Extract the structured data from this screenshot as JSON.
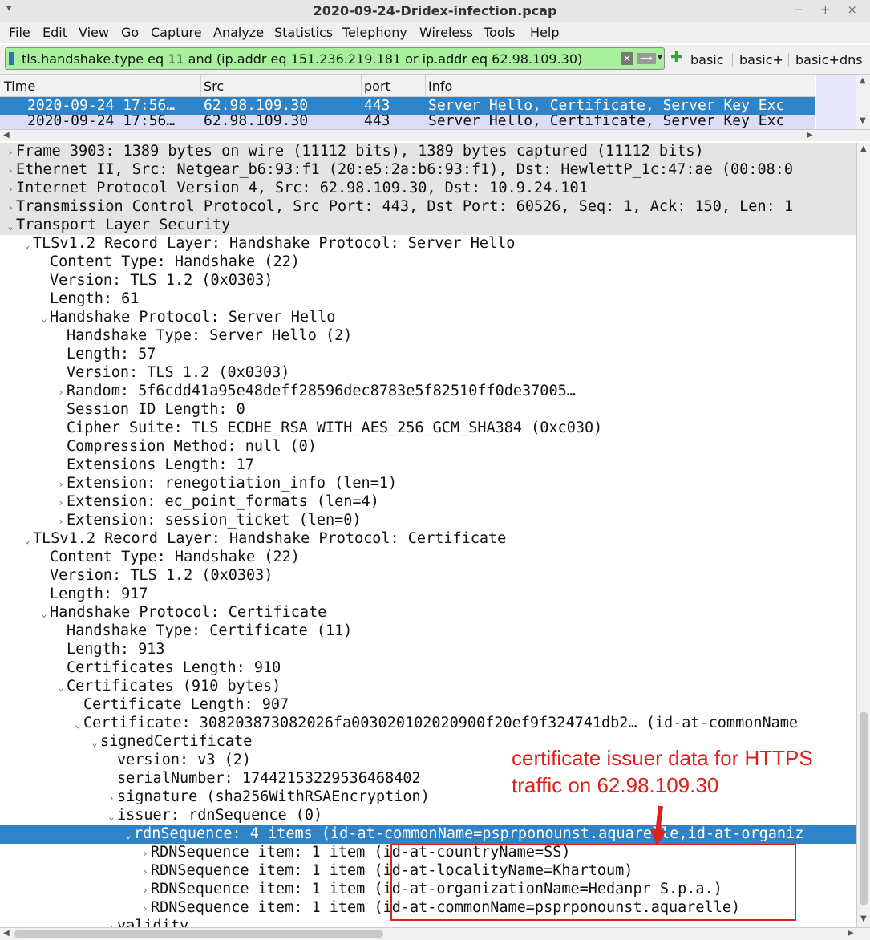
{
  "window": {
    "title": "2020-09-24-Dridex-infection.pcap",
    "menu_glyph": "▾",
    "controls": "− + ×"
  },
  "menubar": [
    "File",
    "Edit",
    "View",
    "Go",
    "Capture",
    "Analyze",
    "Statistics",
    "Telephony",
    "Wireless",
    "Tools",
    "Help"
  ],
  "filter": {
    "value": "tls.handshake.type eq 11 and (ip.addr eq 151.236.219.181 or ip.addr eq 62.98.109.30)",
    "clear_glyph": "✕",
    "apply_glyph": "⟶",
    "dropdown_glyph": "▾",
    "add_glyph": "✚",
    "buttons": [
      "basic",
      "basic+",
      "basic+dns"
    ],
    "bg_color": "#a8f09c"
  },
  "packet_list": {
    "columns": [
      "Time",
      "Src",
      "port",
      "Info"
    ],
    "rows": [
      {
        "time": "2020-09-24 17:56…",
        "src": "62.98.109.30",
        "port": "443",
        "info": "Server Hello, Certificate, Server Key Exc"
      },
      {
        "time": "2020-09-24 17:56…",
        "src": "62.98.109.30",
        "port": "443",
        "info": "Server Hello, Certificate, Server Key Exc"
      }
    ]
  },
  "tree": [
    {
      "t": "Frame 3903: 1389 bytes on wire (11112 bits), 1389 bytes captured (11112 bits)",
      "tog": "›",
      "indent": 0
    },
    {
      "t": "Ethernet II, Src: Netgear_b6:93:f1 (20:e5:2a:b6:93:f1), Dst: HewlettP_1c:47:ae (00:08:0",
      "tog": "›",
      "indent": 0
    },
    {
      "t": "Internet Protocol Version 4, Src: 62.98.109.30, Dst: 10.9.24.101",
      "tog": "›",
      "indent": 0
    },
    {
      "t": "Transmission Control Protocol, Src Port: 443, Dst Port: 60526, Seq: 1, Ack: 150, Len: 1",
      "tog": "›",
      "indent": 0
    },
    {
      "t": "Transport Layer Security",
      "tog": "⌄",
      "indent": 0
    },
    {
      "t": "TLSv1.2 Record Layer: Handshake Protocol: Server Hello",
      "tog": "⌄",
      "indent": 1
    },
    {
      "t": "Content Type: Handshake (22)",
      "tog": "",
      "indent": 2
    },
    {
      "t": "Version: TLS 1.2 (0x0303)",
      "tog": "",
      "indent": 2
    },
    {
      "t": "Length: 61",
      "tog": "",
      "indent": 2
    },
    {
      "t": "Handshake Protocol: Server Hello",
      "tog": "⌄",
      "indent": 2
    },
    {
      "t": "Handshake Type: Server Hello (2)",
      "tog": "",
      "indent": 3
    },
    {
      "t": "Length: 57",
      "tog": "",
      "indent": 3
    },
    {
      "t": "Version: TLS 1.2 (0x0303)",
      "tog": "",
      "indent": 3
    },
    {
      "t": "Random: 5f6cdd41a95e48deff28596dec8783e5f82510ff0de37005…",
      "tog": "›",
      "indent": 3
    },
    {
      "t": "Session ID Length: 0",
      "tog": "",
      "indent": 3
    },
    {
      "t": "Cipher Suite: TLS_ECDHE_RSA_WITH_AES_256_GCM_SHA384 (0xc030)",
      "tog": "",
      "indent": 3
    },
    {
      "t": "Compression Method: null (0)",
      "tog": "",
      "indent": 3
    },
    {
      "t": "Extensions Length: 17",
      "tog": "",
      "indent": 3
    },
    {
      "t": "Extension: renegotiation_info (len=1)",
      "tog": "›",
      "indent": 3
    },
    {
      "t": "Extension: ec_point_formats (len=4)",
      "tog": "›",
      "indent": 3
    },
    {
      "t": "Extension: session_ticket (len=0)",
      "tog": "›",
      "indent": 3
    },
    {
      "t": "TLSv1.2 Record Layer: Handshake Protocol: Certificate",
      "tog": "⌄",
      "indent": 1
    },
    {
      "t": "Content Type: Handshake (22)",
      "tog": "",
      "indent": 2
    },
    {
      "t": "Version: TLS 1.2 (0x0303)",
      "tog": "",
      "indent": 2
    },
    {
      "t": "Length: 917",
      "tog": "",
      "indent": 2
    },
    {
      "t": "Handshake Protocol: Certificate",
      "tog": "⌄",
      "indent": 2
    },
    {
      "t": "Handshake Type: Certificate (11)",
      "tog": "",
      "indent": 3
    },
    {
      "t": "Length: 913",
      "tog": "",
      "indent": 3
    },
    {
      "t": "Certificates Length: 910",
      "tog": "",
      "indent": 3
    },
    {
      "t": "Certificates (910 bytes)",
      "tog": "⌄",
      "indent": 3
    },
    {
      "t": "Certificate Length: 907",
      "tog": "",
      "indent": 4
    },
    {
      "t": "Certificate: 308203873082026fa003020102020900f20ef9f324741db2… (id-at-commonName",
      "tog": "⌄",
      "indent": 4
    },
    {
      "t": "signedCertificate",
      "tog": "⌄",
      "indent": 5
    },
    {
      "t": "version: v3 (2)",
      "tog": "",
      "indent": 6
    },
    {
      "t": "serialNumber: 17442153229536468402",
      "tog": "",
      "indent": 6
    },
    {
      "t": "signature (sha256WithRSAEncryption)",
      "tog": "›",
      "indent": 6
    },
    {
      "t": "issuer: rdnSequence (0)",
      "tog": "⌄",
      "indent": 6
    },
    {
      "t": "rdnSequence: 4 items (id-at-commonName=psprponounst.aquarelle,id-at-organiz",
      "tog": "⌄",
      "indent": 7
    },
    {
      "t": "RDNSequence item: 1 item (id-at-countryName=SS)",
      "tog": "›",
      "indent": 8
    },
    {
      "t": "RDNSequence item: 1 item (id-at-localityName=Khartoum)",
      "tog": "›",
      "indent": 8
    },
    {
      "t": "RDNSequence item: 1 item (id-at-organizationName=Hedanpr S.p.a.)",
      "tog": "›",
      "indent": 8
    },
    {
      "t": "RDNSequence item: 1 item (id-at-commonName=psprponounst.aquarelle)",
      "tog": "›",
      "indent": 8
    },
    {
      "t": "validity",
      "tog": "›",
      "indent": 6
    }
  ],
  "tree_state": {
    "section_rows": [
      0,
      1,
      2,
      3,
      4
    ],
    "selected_row": 37
  },
  "annotation": {
    "line1": "certificate issuer data for HTTPS",
    "line2": "traffic on 62.98.109.30",
    "color": "#e0201a"
  },
  "colors": {
    "selection": "#2f84c7",
    "alt_row": "#dcdcf5",
    "section_bg": "#e4e4e4"
  }
}
